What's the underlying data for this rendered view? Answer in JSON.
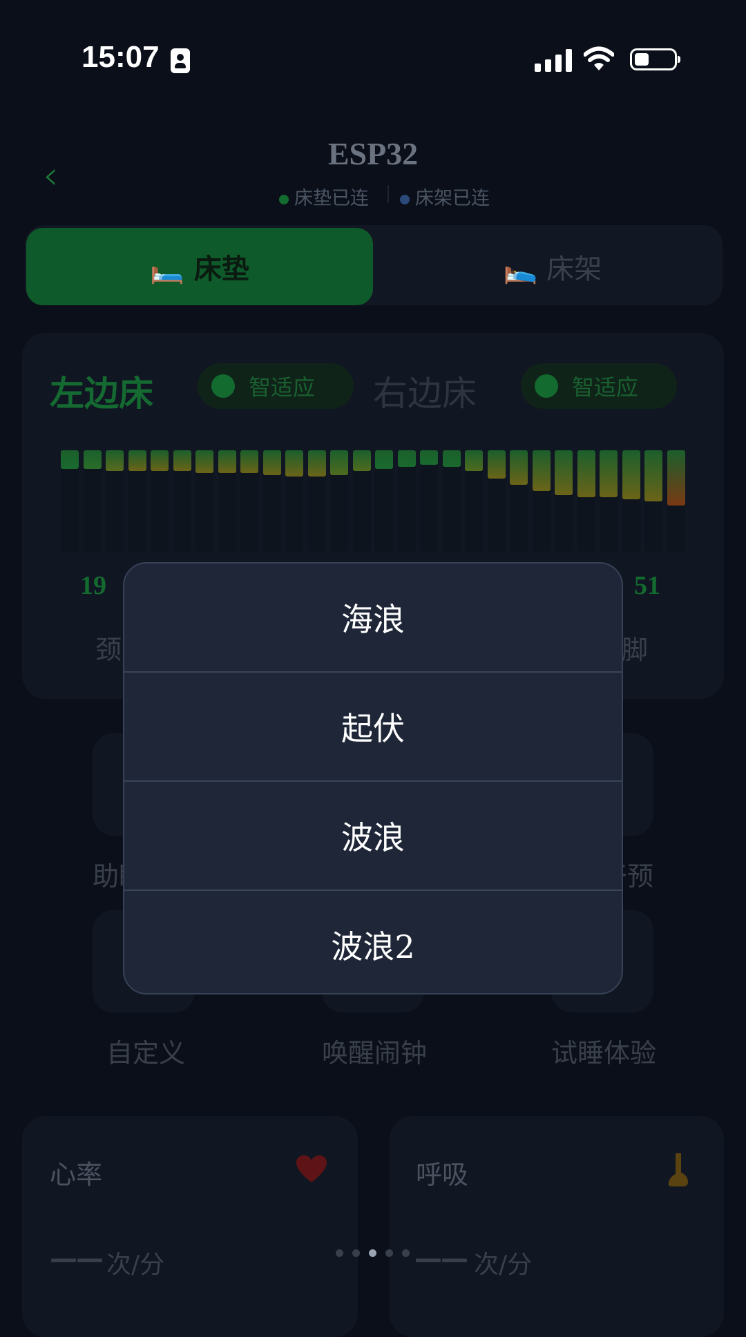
{
  "status_bar": {
    "time": "15:07"
  },
  "header": {
    "title": "ESP32",
    "mattress_status": "床垫已连",
    "frame_status": "床架已连"
  },
  "tabs": {
    "mattress": "🛏️ 床垫",
    "frame": "🛌 床架"
  },
  "beds": {
    "left": "左边床",
    "right": "右边床",
    "left_mode": "智适应",
    "right_mode": "智适应"
  },
  "pressure": {
    "left_value": "19",
    "right_value": "51",
    "left_label": "颈",
    "right_label": "脚",
    "bar_levels": [
      0.18,
      0.18,
      0.2,
      0.2,
      0.2,
      0.2,
      0.22,
      0.22,
      0.22,
      0.24,
      0.26,
      0.26,
      0.24,
      0.2,
      0.18,
      0.16,
      0.14,
      0.16,
      0.2,
      0.28,
      0.34,
      0.4,
      0.44,
      0.46,
      0.46,
      0.48,
      0.5,
      0.54
    ],
    "bar_colors": [
      "#1a6a2e",
      "#2b6e2a",
      "#5a6a1e",
      "#6b6418",
      "#6b6418",
      "#6b6418",
      "#6b6418",
      "#6b6418",
      "#6b6418",
      "#6b6418",
      "#6b6418",
      "#6b6418",
      "#4f6b1f",
      "#4f6b1f",
      "#1a6a2e",
      "#1a6a2e",
      "#1a6a2e",
      "#1a6a2e",
      "#4f6b1f",
      "#6b6418",
      "#6b6418",
      "#6b6418",
      "#6b6418",
      "#6b6418",
      "#6b6418",
      "#6b6418",
      "#6b6418",
      "#7a3a14"
    ]
  },
  "functions": {
    "row1": {
      "left": "助眠",
      "right": "干预"
    },
    "row2": {
      "left": "自定义",
      "middle": "唤醒闹钟",
      "right": "试睡体验"
    }
  },
  "stats": {
    "heart_rate": {
      "title": "心率",
      "value": "——",
      "unit": "次/分",
      "icon": "heart-icon"
    },
    "breathing": {
      "title": "呼吸",
      "value": "——",
      "unit": "次/分",
      "icon": "nose-icon"
    }
  },
  "mode_sheet": {
    "options": [
      "海浪",
      "起伏",
      "波浪",
      "波浪2"
    ]
  },
  "pager": {
    "count": 5,
    "active": 2
  }
}
